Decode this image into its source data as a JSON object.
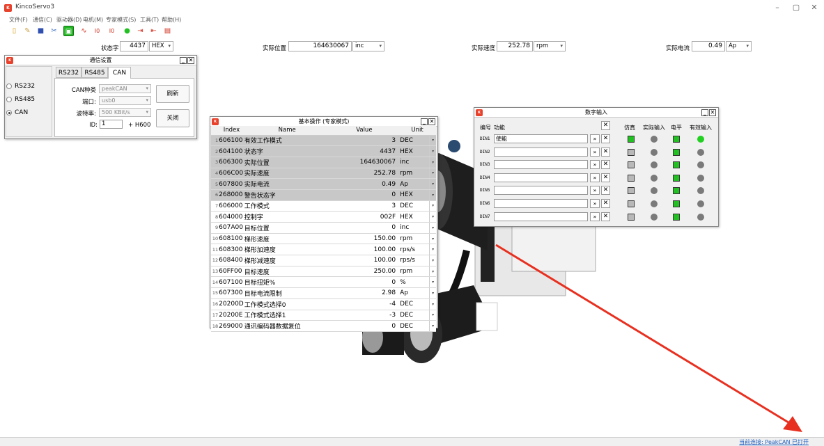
{
  "app": {
    "title": "KincoServo3",
    "logo_text": "K"
  },
  "window_controls": {
    "minimize": "–",
    "restore": "▢",
    "close": "✕"
  },
  "menu": [
    "文件(F)",
    "通信(C)",
    "驱动器(D)",
    "电机(M)",
    "专家模式(S)",
    "工具(T)",
    "帮助(H)"
  ],
  "toolbar_icons": [
    "new-file-icon",
    "open-file-icon",
    "save-icon",
    "settings-icon",
    "connect-icon",
    "oscilloscope-icon",
    "io-in-icon",
    "io-out-icon",
    "status-led-icon",
    "din-icon",
    "dout-icon",
    "error-icon"
  ],
  "status_row": [
    {
      "label": "状态字",
      "value": "4437",
      "unit": "HEX"
    },
    {
      "label": "实际位置",
      "value": "164630067",
      "unit": "inc"
    },
    {
      "label": "实际速度",
      "value": "252.78",
      "unit": "rpm"
    },
    {
      "label": "实际电流",
      "value": "0.49",
      "unit": "Ap"
    }
  ],
  "comm": {
    "title": "通信设置",
    "radios": [
      {
        "label": "RS232",
        "checked": false
      },
      {
        "label": "RS485",
        "checked": false
      },
      {
        "label": "CAN",
        "checked": true
      }
    ],
    "tabs": [
      "RS232",
      "RS485",
      "CAN"
    ],
    "active_tab": "CAN",
    "can_type_label": "CAN种类",
    "can_type_value": "peakCAN",
    "port_label": "端口:",
    "port_value": "usb0",
    "baud_label": "波特率:",
    "baud_value": "500 KBit/s",
    "id_label": "ID:",
    "id_value": "1",
    "id_suffix": "+ H600",
    "refresh_label": "刷新",
    "close_label": "关闭"
  },
  "basic_ops": {
    "title": "基本操作 (专家模式)",
    "columns": [
      "Index",
      "Name",
      "Value",
      "Unit"
    ],
    "rows": [
      {
        "n": "1",
        "index": "606100",
        "name": "有效工作模式",
        "value": "3",
        "unit": "DEC",
        "readonly": true
      },
      {
        "n": "2",
        "index": "604100",
        "name": "状态字",
        "value": "4437",
        "unit": "HEX",
        "readonly": true
      },
      {
        "n": "3",
        "index": "606300",
        "name": "实际位置",
        "value": "164630067",
        "unit": "inc",
        "readonly": true
      },
      {
        "n": "4",
        "index": "606C00",
        "name": "实际速度",
        "value": "252.78",
        "unit": "rpm",
        "readonly": true
      },
      {
        "n": "5",
        "index": "607800",
        "name": "实际电流",
        "value": "0.49",
        "unit": "Ap",
        "readonly": true
      },
      {
        "n": "6",
        "index": "268000",
        "name": "警告状态字",
        "value": "0",
        "unit": "HEX",
        "readonly": true
      },
      {
        "n": "7",
        "index": "606000",
        "name": "工作模式",
        "value": "3",
        "unit": "DEC",
        "readonly": false
      },
      {
        "n": "8",
        "index": "604000",
        "name": "控制字",
        "value": "002F",
        "unit": "HEX",
        "readonly": false
      },
      {
        "n": "9",
        "index": "607A00",
        "name": "目标位置",
        "value": "0",
        "unit": "inc",
        "readonly": false
      },
      {
        "n": "10",
        "index": "608100",
        "name": "梯形速度",
        "value": "150.00",
        "unit": "rpm",
        "readonly": false
      },
      {
        "n": "11",
        "index": "608300",
        "name": "梯形加速度",
        "value": "100.00",
        "unit": "rps/s",
        "readonly": false
      },
      {
        "n": "12",
        "index": "608400",
        "name": "梯形减速度",
        "value": "100.00",
        "unit": "rps/s",
        "readonly": false
      },
      {
        "n": "13",
        "index": "60FF00",
        "name": "目标速度",
        "value": "250.00",
        "unit": "rpm",
        "readonly": false
      },
      {
        "n": "14",
        "index": "607100",
        "name": "目标扭矩%",
        "value": "0",
        "unit": "%",
        "readonly": false
      },
      {
        "n": "15",
        "index": "607300",
        "name": "目标电流限制",
        "value": "2.98",
        "unit": "Ap",
        "readonly": false
      },
      {
        "n": "16",
        "index": "20200D",
        "name": "工作模式选择0",
        "value": "-4",
        "unit": "DEC",
        "readonly": false
      },
      {
        "n": "17",
        "index": "20200E",
        "name": "工作模式选择1",
        "value": "-3",
        "unit": "DEC",
        "readonly": false
      },
      {
        "n": "18",
        "index": "269000",
        "name": "通讯编码器数据复位",
        "value": "0",
        "unit": "DEC",
        "readonly": false
      }
    ]
  },
  "digital_input": {
    "title": "数字输入",
    "headers": {
      "no": "编号",
      "func": "功能",
      "clear": "✕",
      "sim": "仿真",
      "actual": "实际输入",
      "level": "电平",
      "effective": "有效输入"
    },
    "rows": [
      {
        "label": "DIN1",
        "function": "使能",
        "sim": "green",
        "actual": false,
        "level": "green",
        "effective": true
      },
      {
        "label": "DIN2",
        "function": "",
        "sim": "gray",
        "actual": false,
        "level": "green",
        "effective": false
      },
      {
        "label": "DIN3",
        "function": "",
        "sim": "gray",
        "actual": false,
        "level": "green",
        "effective": false
      },
      {
        "label": "DIN4",
        "function": "",
        "sim": "gray",
        "actual": false,
        "level": "green",
        "effective": false
      },
      {
        "label": "DIN5",
        "function": "",
        "sim": "gray",
        "actual": false,
        "level": "green",
        "effective": false
      },
      {
        "label": "DIN6",
        "function": "",
        "sim": "gray",
        "actual": false,
        "level": "green",
        "effective": false
      },
      {
        "label": "DIN7",
        "function": "",
        "sim": "gray",
        "actual": false,
        "level": "green",
        "effective": false
      }
    ],
    "btn_more": "»",
    "btn_clear": "✕"
  },
  "status_bar": {
    "connection": "当前连接: PeakCAN 已打开"
  },
  "colors": {
    "accent": "#e8412c",
    "led_on": "#22d022",
    "led_off": "#7a7a7a",
    "readonly_row": "#c8c8c8",
    "arrow": "#e83020"
  }
}
